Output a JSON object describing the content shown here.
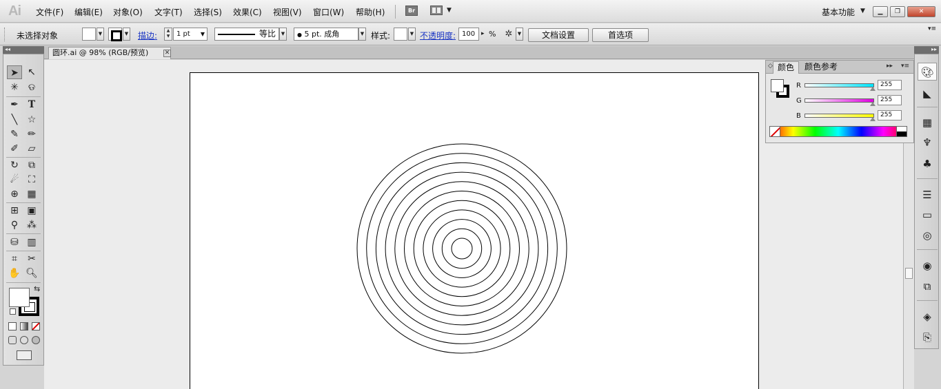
{
  "app": {
    "logo": "Ai"
  },
  "menu": [
    "文件(F)",
    "编辑(E)",
    "对象(O)",
    "文字(T)",
    "选择(S)",
    "效果(C)",
    "视图(V)",
    "窗口(W)",
    "帮助(H)"
  ],
  "menubar_right": {
    "bridge": "Br",
    "workspace": "基本功能"
  },
  "control": {
    "selection_status": "未选择对象",
    "stroke_label": "描边:",
    "stroke_weight": "1 pt",
    "stroke_profile": "等比",
    "brush": "5 pt. 成角",
    "style_label": "样式:",
    "opacity_label": "不透明度:",
    "opacity_value": "100",
    "opacity_unit": "%",
    "doc_setup": "文档设置",
    "preferences": "首选项"
  },
  "document": {
    "tab_title": "圆环.ai @ 98% (RGB/预览)"
  },
  "color_panel": {
    "tabs": [
      "颜色",
      "颜色参考"
    ],
    "channels": [
      {
        "label": "R",
        "value": "255",
        "color": "#00e5ff"
      },
      {
        "label": "G",
        "value": "255",
        "color": "#e000e0"
      },
      {
        "label": "B",
        "value": "255",
        "color": "#ffff00"
      }
    ]
  },
  "artwork": {
    "ring_count": 11,
    "shape": "concentric-circles"
  }
}
